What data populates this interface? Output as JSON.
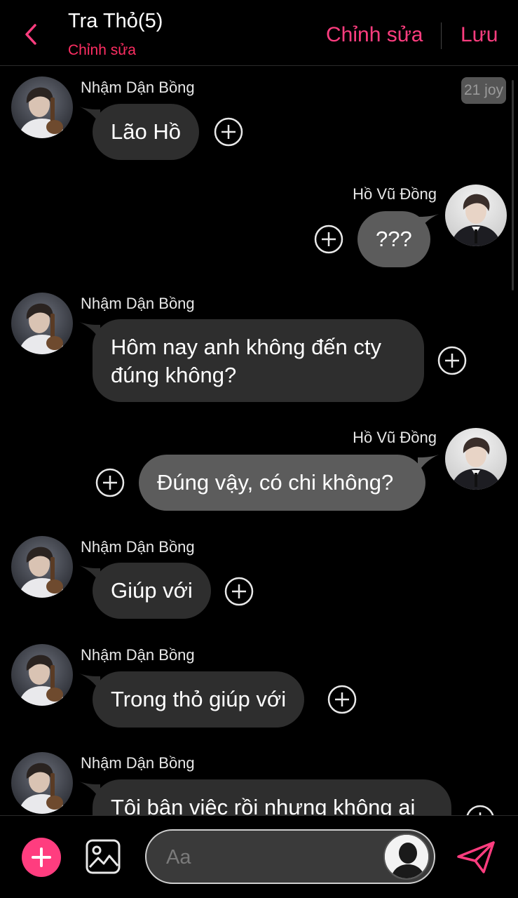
{
  "header": {
    "title": "Tra Thỏ(5)",
    "subtitle": "Chỉnh sửa",
    "edit_label": "Chỉnh sửa",
    "save_label": "Lưu"
  },
  "badge": {
    "time": "21 joy"
  },
  "messages": [
    {
      "sender": "Nhậm Dận Bồng",
      "side": "left",
      "text": "Lão Hồ"
    },
    {
      "sender": "Hồ Vũ Đồng",
      "side": "right",
      "text": "???"
    },
    {
      "sender": "Nhậm Dận Bồng",
      "side": "left",
      "line1": "Hôm nay anh không đến cty",
      "line2": "đúng không?"
    },
    {
      "sender": "Hồ Vũ Đồng",
      "side": "right",
      "text": "Đúng vậy, có chi không?"
    },
    {
      "sender": "Nhậm Dận Bồng",
      "side": "left",
      "text": "Giúp với"
    },
    {
      "sender": "Nhậm Dận Bồng",
      "side": "left",
      "text": "Trong thỏ giúp với"
    },
    {
      "sender": "Nhậm Dận Bồng",
      "side": "left",
      "text": "Tôi bận việc rồi nhưng không ai"
    }
  ],
  "composer": {
    "placeholder": "Aa"
  },
  "colors": {
    "accent": "#ff3d7f",
    "subtitle": "#ff2e63",
    "bubble_in": "#2e2e2e",
    "bubble_out": "#5c5c5c"
  }
}
